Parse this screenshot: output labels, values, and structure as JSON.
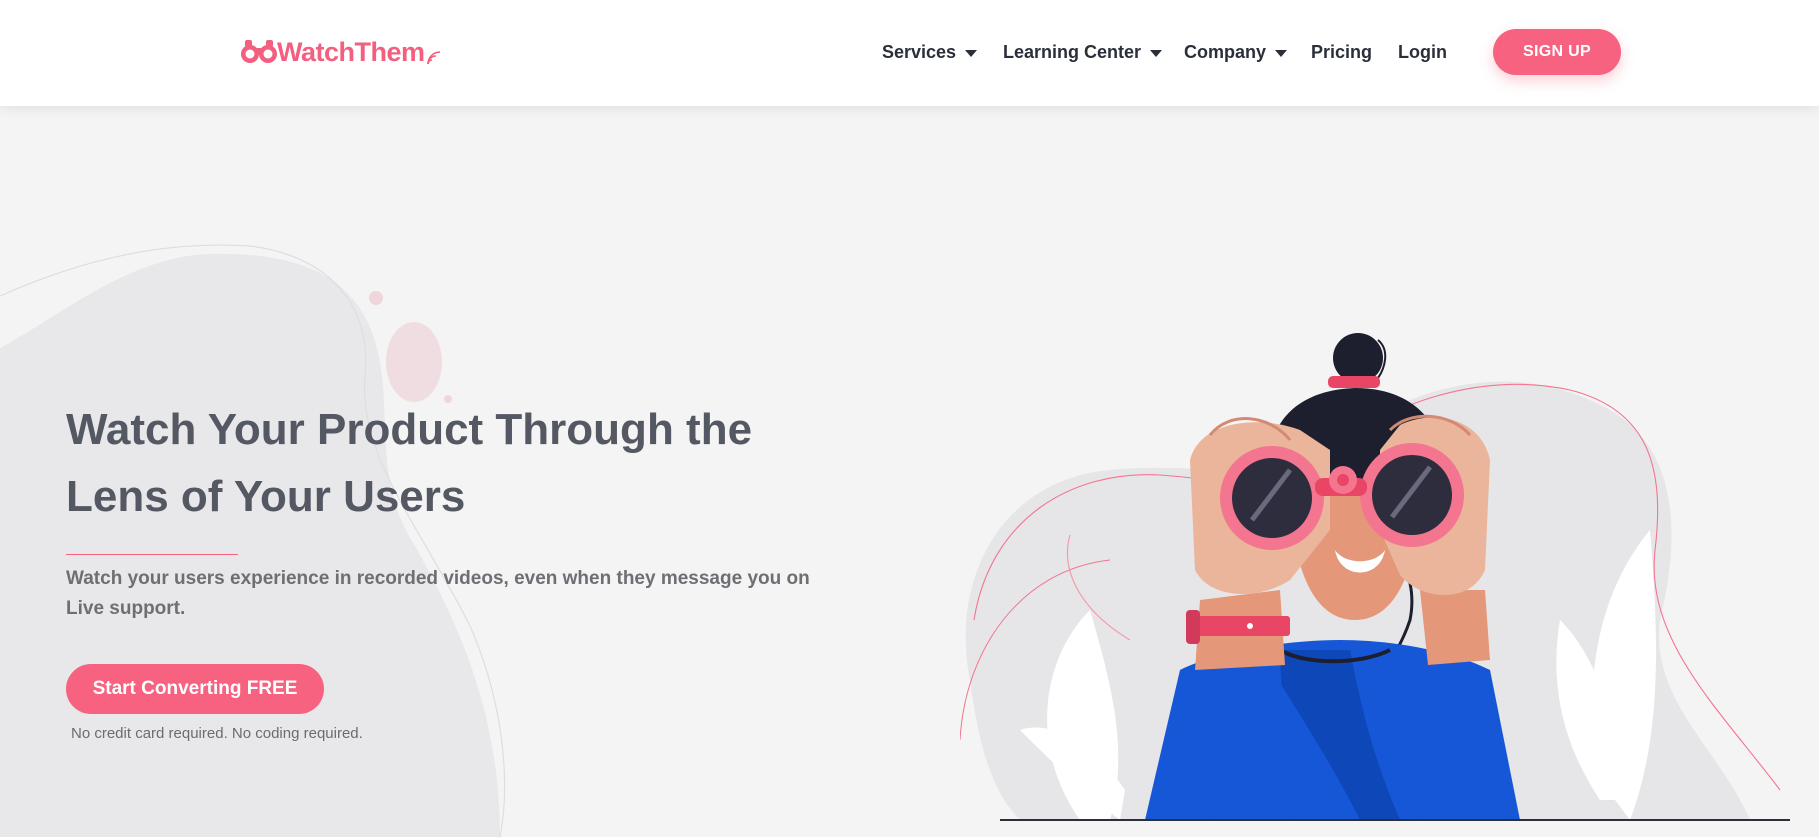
{
  "header": {
    "logo_text": "WatchThem",
    "nav": [
      {
        "label": "Services",
        "has_dropdown": true
      },
      {
        "label": "Learning Center",
        "has_dropdown": true
      },
      {
        "label": "Company",
        "has_dropdown": true
      },
      {
        "label": "Pricing",
        "has_dropdown": false
      },
      {
        "label": "Login",
        "has_dropdown": false
      }
    ],
    "signup_label": "SIGN UP"
  },
  "hero": {
    "title": "Watch Your Product Through the Lens of Your Users",
    "subtitle": "Watch your users experience in recorded videos, even when they message you on Live support.",
    "cta_label": "Start Converting FREE",
    "cta_note": "No credit card required. No coding required."
  },
  "colors": {
    "brand": "#f6627f",
    "nav_text": "#2b2f3a",
    "heading": "#545862",
    "background": "#f4f4f4",
    "shirt": "#1557d6"
  },
  "illustration": {
    "subject": "woman-with-binoculars"
  }
}
